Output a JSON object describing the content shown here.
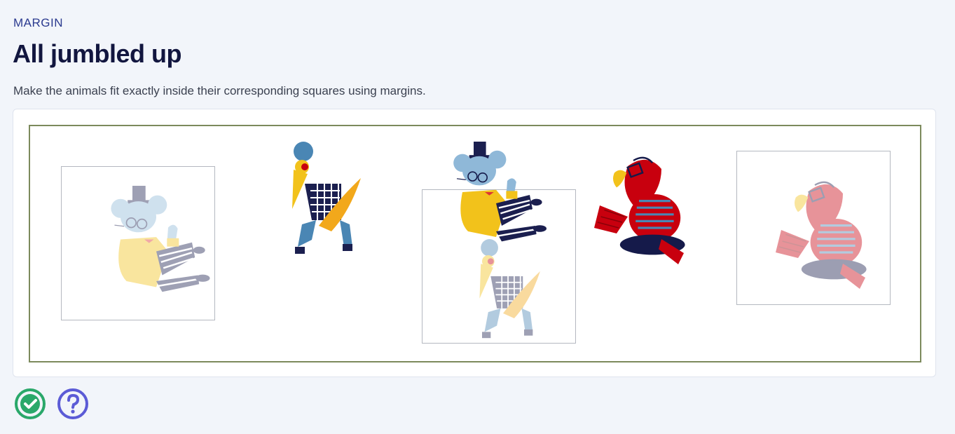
{
  "header": {
    "category": "MARGIN",
    "title": "All jumbled up",
    "description": "Make the animals fit exactly inside their corresponding squares using margins."
  },
  "colors": {
    "background": "#f2f5fa",
    "title": "#12163f",
    "category": "#2b3a8f",
    "stage_border": "#7c8a5c",
    "check_green": "#2aa86a",
    "help_purple": "#5b5bd6",
    "mouse_blue": "#8fb8d8",
    "jacket_yellow": "#f2c21b",
    "parrot_red": "#c8000e",
    "navy": "#151a4a"
  },
  "stage": {
    "targets": [
      {
        "animal": "mouse",
        "icon": "mouse-silhouette"
      },
      {
        "animal": "bird",
        "icon": "bird-silhouette"
      },
      {
        "animal": "parrot",
        "icon": "parrot-silhouette"
      }
    ],
    "animals": [
      {
        "name": "heron",
        "icon": "heron-illustration"
      },
      {
        "name": "mouse",
        "icon": "mouse-illustration"
      },
      {
        "name": "parrot",
        "icon": "parrot-illustration"
      }
    ]
  },
  "actions": {
    "check": {
      "icon": "check-circle-icon"
    },
    "help": {
      "icon": "question-circle-icon"
    }
  }
}
